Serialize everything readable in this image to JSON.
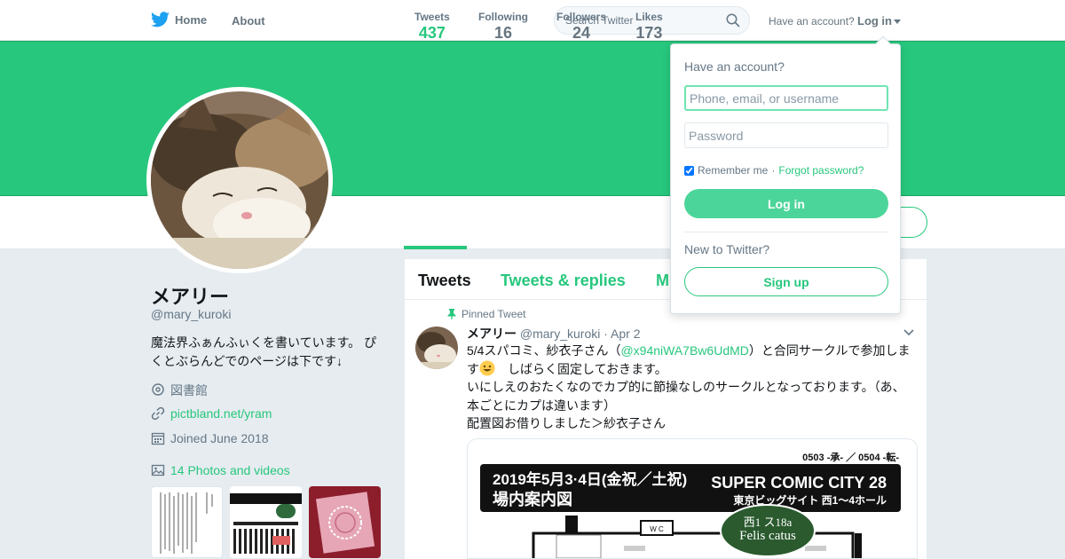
{
  "nav": {
    "home_label": "Home",
    "about_label": "About",
    "search_placeholder": "Search Twitter",
    "have_account_text": "Have an account?",
    "login_label": "Log in"
  },
  "colors": {
    "brand": "#27c77d",
    "brand_button": "#4cd59a",
    "twitter_blue": "#1da1f2"
  },
  "stats": [
    {
      "label": "Tweets",
      "value": "437"
    },
    {
      "label": "Following",
      "value": "16"
    },
    {
      "label": "Followers",
      "value": "24"
    },
    {
      "label": "Likes",
      "value": "173"
    }
  ],
  "profile": {
    "name": "メアリー",
    "handle": "@mary_kuroki",
    "bio": "魔法界ふぁんふぃくを書いています。 ぴくとぶらんどでのページは下です↓",
    "location": "図書館",
    "website": "pictbland.net/yram",
    "joined": "Joined June 2018",
    "photos_link": "14 Photos and videos"
  },
  "timeline": {
    "tabs": [
      "Tweets",
      "Tweets & replies",
      "M"
    ],
    "pinned_label": "Pinned Tweet",
    "tweet": {
      "name": "メアリー",
      "handle": "@mary_kuroki",
      "separator": "·",
      "date": "Apr 2",
      "line1_prefix": "5/4スパコミ、紗衣子さん（",
      "mention": "@x94niWA7Bw6UdMD",
      "line1_suffix": "）と合同サークルで参加しま",
      "line2_prefix": "す",
      "line2_suffix": "　しばらく固定しておきます。",
      "line3": "いにしえのおたくなのでカプ的に節操なしのサークルとなっております。（あ、本ごとにカプは違います）",
      "line4": "配置図お借りしました＞紗衣子さん"
    },
    "media": {
      "top_right": "0503 -承- ／ 0504 -転-",
      "banner_left_1": "2019年5月3·4日(金祝／土祝)",
      "banner_left_2": "場内案内図",
      "banner_right_1": "SUPER COMIC CITY 28",
      "banner_right_2": "東京ビッグサイト 西1〜4ホール",
      "oval_line1": "西1 ス18a",
      "oval_line2": "Felis catus",
      "wc_label": "W C"
    }
  },
  "login_dropdown": {
    "title": "Have an account?",
    "username_placeholder": "Phone, email, or username",
    "password_placeholder": "Password",
    "remember_label": "Remember me",
    "dot": "·",
    "forgot_label": "Forgot password?",
    "login_button": "Log in",
    "new_text": "New to Twitter?",
    "signup_button": "Sign up"
  }
}
